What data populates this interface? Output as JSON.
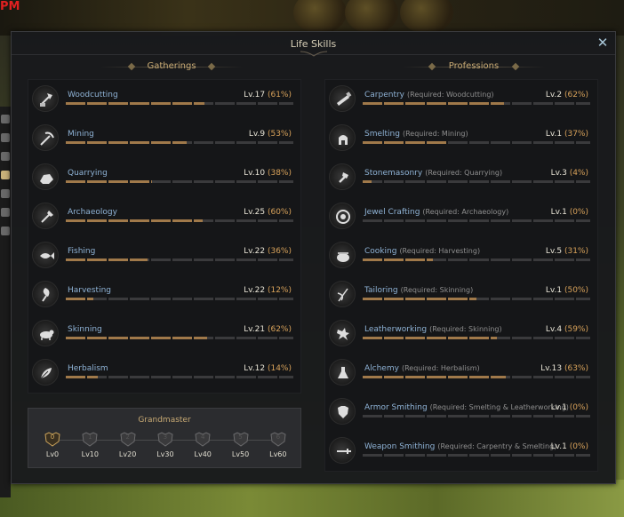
{
  "background": {
    "corner_text": "PM"
  },
  "window": {
    "title": "Life Skills",
    "close_icon": "close-x-icon"
  },
  "gatherings": {
    "header": "Gatherings",
    "skills": [
      {
        "name": "Woodcutting",
        "level": "Lv.17",
        "percent": "(61%)",
        "progress": 0.61,
        "icon": "axe-log-icon"
      },
      {
        "name": "Mining",
        "level": "Lv.9",
        "percent": "(53%)",
        "progress": 0.53,
        "icon": "pickaxe-icon"
      },
      {
        "name": "Quarrying",
        "level": "Lv.10",
        "percent": "(38%)",
        "progress": 0.38,
        "icon": "stone-icon"
      },
      {
        "name": "Archaeology",
        "level": "Lv.25",
        "percent": "(60%)",
        "progress": 0.6,
        "icon": "shovel-icon"
      },
      {
        "name": "Fishing",
        "level": "Lv.22",
        "percent": "(36%)",
        "progress": 0.36,
        "icon": "fish-icon"
      },
      {
        "name": "Harvesting",
        "level": "Lv.22",
        "percent": "(12%)",
        "progress": 0.12,
        "icon": "sickle-icon"
      },
      {
        "name": "Skinning",
        "level": "Lv.21",
        "percent": "(62%)",
        "progress": 0.62,
        "icon": "animal-icon"
      },
      {
        "name": "Herbalism",
        "level": "Lv.12",
        "percent": "(14%)",
        "progress": 0.14,
        "icon": "leaf-icon"
      }
    ]
  },
  "professions": {
    "header": "Professions",
    "skills": [
      {
        "name": "Carpentry",
        "req": "(Required: Woodcutting)",
        "level": "Lv.2",
        "percent": "(62%)",
        "progress": 0.62,
        "icon": "saw-icon"
      },
      {
        "name": "Smelting",
        "req": "(Required: Mining)",
        "level": "Lv.1",
        "percent": "(37%)",
        "progress": 0.37,
        "icon": "furnace-icon"
      },
      {
        "name": "Stonemasonry",
        "req": "(Required: Quarrying)",
        "level": "Lv.3",
        "percent": "(4%)",
        "progress": 0.04,
        "icon": "chisel-icon"
      },
      {
        "name": "Jewel Crafting",
        "req": "(Required: Archaeology)",
        "level": "Lv.1",
        "percent": "(0%)",
        "progress": 0.0,
        "icon": "gem-icon"
      },
      {
        "name": "Cooking",
        "req": "(Required: Harvesting)",
        "level": "Lv.5",
        "percent": "(31%)",
        "progress": 0.31,
        "icon": "pot-icon"
      },
      {
        "name": "Tailoring",
        "req": "(Required: Skinning)",
        "level": "Lv.1",
        "percent": "(50%)",
        "progress": 0.5,
        "icon": "needle-icon"
      },
      {
        "name": "Leatherworking",
        "req": "(Required: Skinning)",
        "level": "Lv.4",
        "percent": "(59%)",
        "progress": 0.59,
        "icon": "hide-icon"
      },
      {
        "name": "Alchemy",
        "req": "(Required: Herbalism)",
        "level": "Lv.13",
        "percent": "(63%)",
        "progress": 0.63,
        "icon": "flask-icon"
      },
      {
        "name": "Armor Smithing",
        "req": "(Required: Smelting & Leatherworking)",
        "level": "Lv.1",
        "percent": "(0%)",
        "progress": 0.0,
        "icon": "armor-icon"
      },
      {
        "name": "Weapon Smithing",
        "req": "(Required: Carpentry & Smelting)",
        "level": "Lv.1",
        "percent": "(0%)",
        "progress": 0.0,
        "icon": "sword-icon"
      }
    ]
  },
  "grandmaster": {
    "title": "Grandmaster",
    "tiers": [
      {
        "num": "0",
        "label": "Lv0",
        "active": true
      },
      {
        "num": "1",
        "label": "Lv10",
        "active": false
      },
      {
        "num": "2",
        "label": "Lv20",
        "active": false
      },
      {
        "num": "3",
        "label": "Lv30",
        "active": false
      },
      {
        "num": "4",
        "label": "Lv40",
        "active": false
      },
      {
        "num": "5",
        "label": "Lv50",
        "active": false
      },
      {
        "num": "6",
        "label": "Lv60",
        "active": false
      }
    ]
  },
  "colors": {
    "skill_name": "#8fb3d6",
    "percent": "#d8a25a",
    "bar_fill": "#a0794a",
    "section_header": "#c8aa74"
  }
}
